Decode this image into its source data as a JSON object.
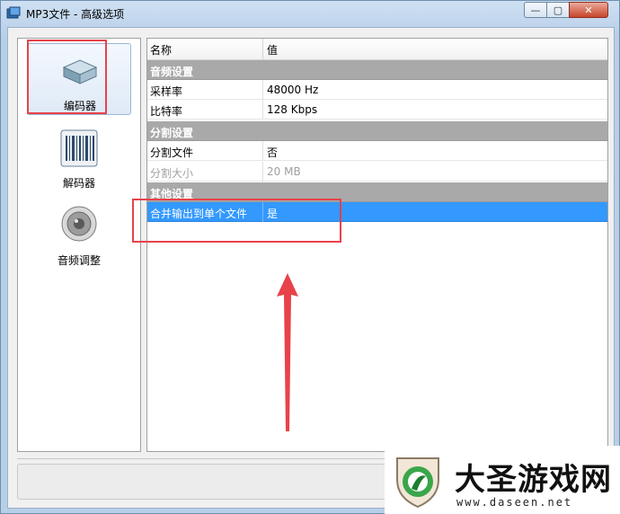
{
  "window": {
    "title": "MP3文件 - 高级选项",
    "controls": {
      "minimize": "—",
      "maximize": "▢",
      "close": "✕"
    }
  },
  "sidebar": {
    "items": [
      {
        "label": "编码器",
        "icon": "encoder-box-icon",
        "selected": true
      },
      {
        "label": "解码器",
        "icon": "barcode-decoder-icon",
        "selected": false
      },
      {
        "label": "音频调整",
        "icon": "speaker-icon",
        "selected": false
      }
    ]
  },
  "grid": {
    "headers": {
      "name": "名称",
      "value": "值"
    },
    "sections": [
      {
        "title": "音频设置",
        "rows": [
          {
            "name": "采样率",
            "value": "48000 Hz"
          },
          {
            "name": "比特率",
            "value": "128 Kbps"
          }
        ]
      },
      {
        "title": "分割设置",
        "rows": [
          {
            "name": "分割文件",
            "value": "否"
          },
          {
            "name": "分割大小",
            "value": "20 MB",
            "disabled": true
          }
        ]
      },
      {
        "title": "其他设置",
        "rows": [
          {
            "name": "合并输出到单个文件",
            "value": "是",
            "selected": true
          }
        ]
      }
    ]
  },
  "annotations": {
    "highlight_color": "#e8424a"
  },
  "watermark": {
    "title": "大圣游戏网",
    "url": "www.daseen.net"
  },
  "colors": {
    "selection": "#3399ff",
    "section_header": "#a9a9a9"
  }
}
